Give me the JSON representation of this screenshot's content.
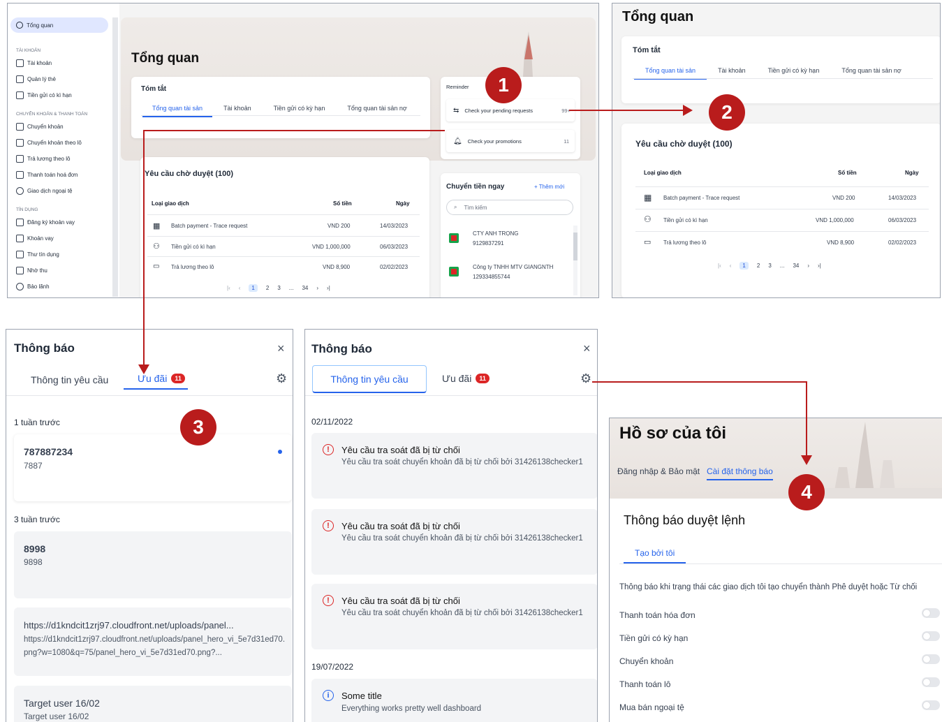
{
  "panel1": {
    "sidebar": {
      "active": "Tổng quan",
      "sections": [
        {
          "title": "TÀI KHOẢN",
          "items": [
            "Tài khoản",
            "Quản lý thẻ",
            "Tiền gửi có kì hạn"
          ]
        },
        {
          "title": "CHUYỂN KHOẢN & THANH TOÁN",
          "items": [
            "Chuyển khoản",
            "Chuyển khoản theo lô",
            "Trả lương theo lô",
            "Thanh toán hoá đơn",
            "Giao dịch ngoại tệ"
          ]
        },
        {
          "title": "TÍN DỤNG",
          "items": [
            "Đăng ký khoản vay",
            "Khoản vay",
            "Thư tín dụng",
            "Nhờ thu",
            "Bảo lãnh"
          ]
        }
      ]
    },
    "page_title": "Tổng quan",
    "summary_title": "Tóm tắt",
    "tabs": [
      "Tổng quan tài sản",
      "Tài khoản",
      "Tiền gửi có kỳ hạn",
      "Tổng quan tài sản nợ"
    ],
    "reminder": {
      "title": "Reminder",
      "items": [
        {
          "label": "Check your pending requests",
          "count": "99+"
        },
        {
          "label": "Check your promotions",
          "count": "11"
        }
      ]
    },
    "pending_title": "Yêu cầu chờ duyệt (100)",
    "table": {
      "headers": [
        "Loại giao dịch",
        "Số tiền",
        "Ngày"
      ],
      "rows": [
        [
          "Batch payment - Trace request",
          "VND 200",
          "14/03/2023"
        ],
        [
          "Tiền gửi có kì hạn",
          "VND 1,000,000",
          "06/03/2023"
        ],
        [
          "Trả lương theo lô",
          "VND 8,900",
          "02/02/2023"
        ]
      ]
    },
    "pager": [
      "1",
      "2",
      "3",
      "...",
      "34"
    ],
    "transfer": {
      "title": "Chuyển tiền ngay",
      "add": "+ Thêm mới",
      "search_placeholder": "Tìm kiếm",
      "contacts": [
        {
          "name": "CTY ANH TRỌNG",
          "number": "9129837291"
        },
        {
          "name": "Công ty TNHH MTV GIANGNTH",
          "number": "129334855744"
        }
      ]
    }
  },
  "panel2": {
    "page_title": "Tổng quan",
    "summary_title": "Tóm tắt",
    "tabs": [
      "Tổng quan tài sản",
      "Tài khoản",
      "Tiền gửi có kỳ hạn",
      "Tổng quan tài sản nợ"
    ],
    "pending_title": "Yêu cầu chờ duyệt (100)",
    "table": {
      "headers": [
        "Loại giao dịch",
        "Số tiền",
        "Ngày"
      ],
      "rows": [
        [
          "Batch payment - Trace request",
          "VND 200",
          "14/03/2023"
        ],
        [
          "Tiền gửi có kì hạn",
          "VND 1,000,000",
          "06/03/2023"
        ],
        [
          "Trả lương theo lô",
          "VND 8,900",
          "02/02/2023"
        ]
      ]
    },
    "pager": [
      "1",
      "2",
      "3",
      "...",
      "34"
    ]
  },
  "panel3": {
    "title": "Thông báo",
    "tabs": {
      "requests": "Thông tin yêu cầu",
      "promos": "Ưu đãi",
      "promo_count": "11"
    },
    "groups": [
      {
        "label": "1 tuần trước"
      },
      {
        "label": "3 tuần trước"
      }
    ],
    "items": [
      {
        "title": "787887234",
        "body": "7887"
      },
      {
        "title": "8998",
        "body": "9898"
      },
      {
        "title": "https://d1kndcit1zrj97.cloudfront.net/uploads/panel...",
        "body": "https://d1kndcit1zrj97.cloudfront.net/uploads/panel_hero_vi_5e7d31ed70.png?w=1080&q=75/panel_hero_vi_5e7d31ed70.png?..."
      },
      {
        "title": "Target user 16/02",
        "body": "Target user 16/02"
      }
    ]
  },
  "panel4": {
    "title": "Thông báo",
    "tabs": {
      "requests": "Thông tin yêu cầu",
      "promos": "Ưu đãi",
      "promo_count": "11"
    },
    "date1": "02/11/2022",
    "date2": "19/07/2022",
    "items": [
      {
        "title": "Yêu cầu tra soát đã bị từ chối",
        "body": "Yêu cầu tra soát chuyển khoản đã bị từ chối bởi 31426138checker1"
      },
      {
        "title": "Yêu cầu tra soát đã bị từ chối",
        "body": "Yêu cầu tra soát chuyển khoản đã bị từ chối bởi 31426138checker1"
      },
      {
        "title": "Yêu cầu tra soát đã bị từ chối",
        "body": "Yêu cầu tra soát chuyển khoản đã bị từ chối bởi 31426138checker1"
      }
    ],
    "info": {
      "title": "Some title",
      "body": "Everything works pretty well dashboard"
    }
  },
  "panel5": {
    "title": "Hồ sơ của tôi",
    "tabs": [
      "Đăng nhập & Bảo mật",
      "Cài đặt thông báo"
    ],
    "section_title": "Thông báo duyệt lệnh",
    "subtab": "Tạo bởi tôi",
    "description": "Thông báo khi trạng thái các giao dịch tôi tạo chuyển thành Phê duyệt hoặc Từ chối",
    "toggles": [
      "Thanh toán hóa đơn",
      "Tiền gửi có kỳ hạn",
      "Chuyển khoản",
      "Thanh toán lô",
      "Mua bán ngoại tệ"
    ]
  },
  "markers": [
    "1",
    "2",
    "3",
    "4"
  ],
  "colors": {
    "accent": "#2563eb",
    "marker": "#b91c1c",
    "badge": "#dc2626"
  }
}
